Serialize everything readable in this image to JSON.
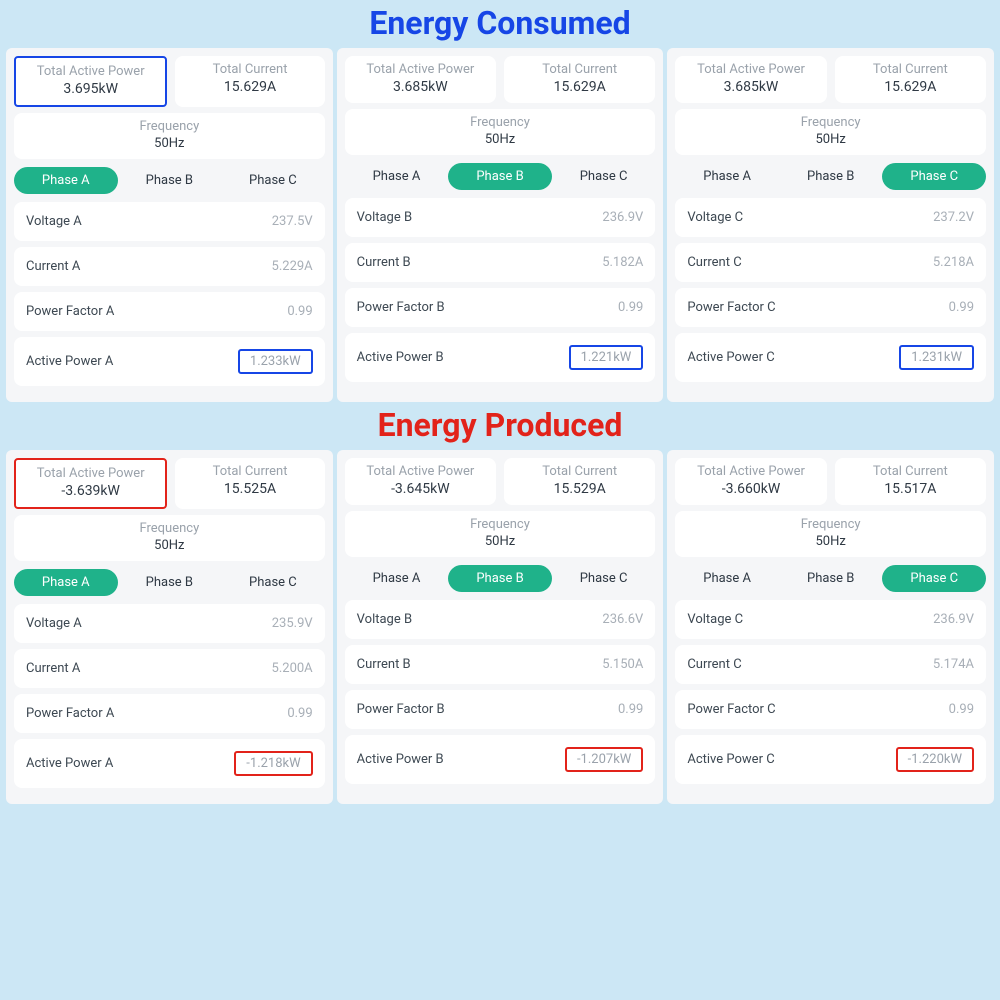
{
  "titles": {
    "consumed": "Energy Consumed",
    "produced": "Energy Produced"
  },
  "labels": {
    "total_active_power": "Total Active Power",
    "total_current": "Total Current",
    "frequency": "Frequency",
    "phaseA": "Phase A",
    "phaseB": "Phase B",
    "phaseC": "Phase C",
    "voltageA": "Voltage A",
    "voltageB": "Voltage B",
    "voltageC": "Voltage C",
    "currentA": "Current A",
    "currentB": "Current B",
    "currentC": "Current C",
    "pfA": "Power Factor A",
    "pfB": "Power Factor B",
    "pfC": "Power Factor C",
    "apA": "Active Power A",
    "apB": "Active Power B",
    "apC": "Active Power C"
  },
  "consumed": [
    {
      "total_active_power": "3.695kW",
      "total_current": "15.629A",
      "frequency": "50Hz",
      "active_phase": "A",
      "voltage": "237.5V",
      "current": "5.229A",
      "pf": "0.99",
      "active_power": "1.233kW"
    },
    {
      "total_active_power": "3.685kW",
      "total_current": "15.629A",
      "frequency": "50Hz",
      "active_phase": "B",
      "voltage": "236.9V",
      "current": "5.182A",
      "pf": "0.99",
      "active_power": "1.221kW"
    },
    {
      "total_active_power": "3.685kW",
      "total_current": "15.629A",
      "frequency": "50Hz",
      "active_phase": "C",
      "voltage": "237.2V",
      "current": "5.218A",
      "pf": "0.99",
      "active_power": "1.231kW"
    }
  ],
  "produced": [
    {
      "total_active_power": "-3.639kW",
      "total_current": "15.525A",
      "frequency": "50Hz",
      "active_phase": "A",
      "voltage": "235.9V",
      "current": "5.200A",
      "pf": "0.99",
      "active_power": "-1.218kW"
    },
    {
      "total_active_power": "-3.645kW",
      "total_current": "15.529A",
      "frequency": "50Hz",
      "active_phase": "B",
      "voltage": "236.6V",
      "current": "5.150A",
      "pf": "0.99",
      "active_power": "-1.207kW"
    },
    {
      "total_active_power": "-3.660kW",
      "total_current": "15.517A",
      "frequency": "50Hz",
      "active_phase": "C",
      "voltage": "236.9V",
      "current": "5.174A",
      "pf": "0.99",
      "active_power": "-1.220kW"
    }
  ]
}
